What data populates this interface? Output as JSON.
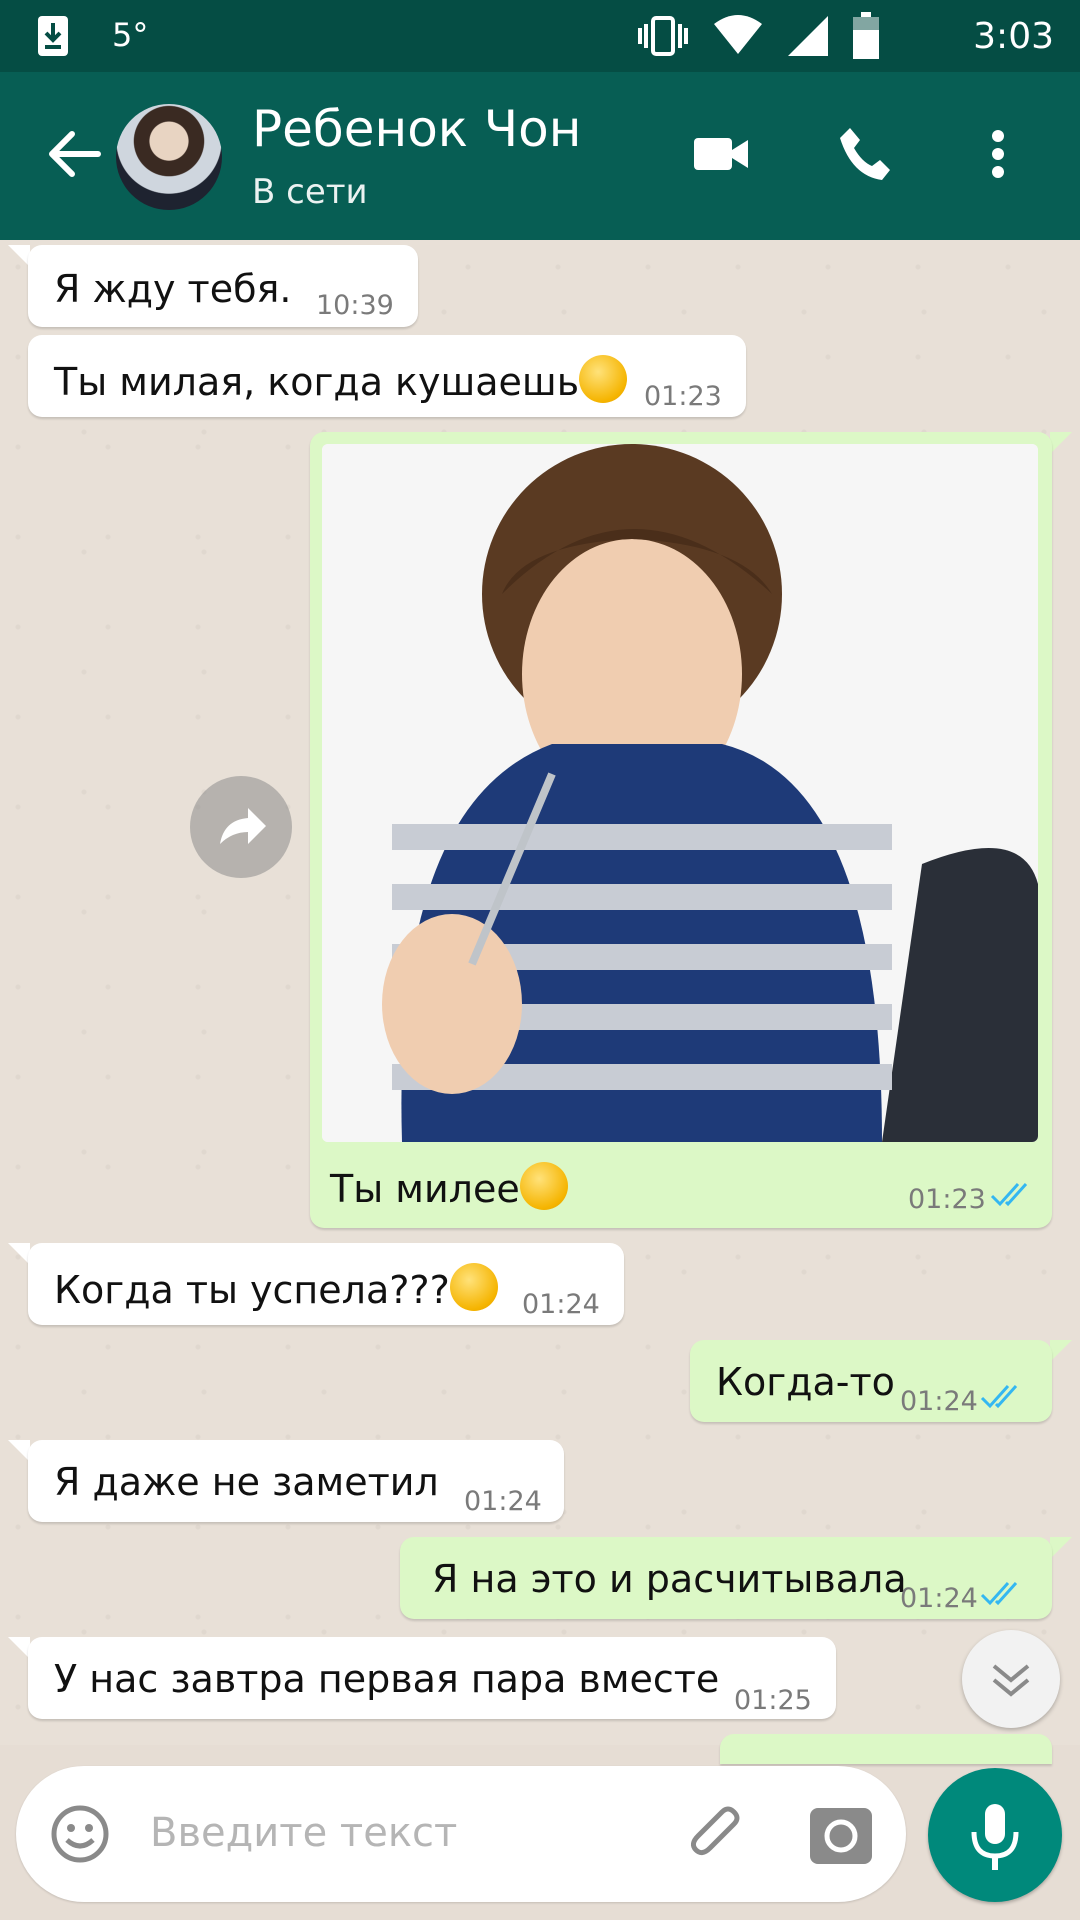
{
  "status_bar": {
    "temperature": "5°",
    "time": "3:03",
    "icons": [
      "download-icon",
      "vibrate-icon",
      "wifi-icon",
      "signal-icon",
      "battery-icon"
    ]
  },
  "header": {
    "contact_name": "Ребенок Чон",
    "contact_status": "В сети",
    "icons": [
      "back-arrow-icon",
      "video-call-icon",
      "phone-icon",
      "more-vert-icon"
    ]
  },
  "messages": [
    {
      "direction": "in",
      "text": "Я жду тебя.",
      "time": "10:39"
    },
    {
      "direction": "in",
      "text": "Ты милая, когда кушаешь",
      "emoji": "smiling-face-emoji",
      "time": "01:23"
    },
    {
      "direction": "out",
      "type": "image",
      "caption": "Ты милее",
      "emoji": "grinning-face-emoji",
      "time": "01:23",
      "read": true
    },
    {
      "direction": "in",
      "text": "Когда ты успела???",
      "emoji": "surprised-face-emoji",
      "time": "01:24"
    },
    {
      "direction": "out",
      "text": "Когда-то",
      "time": "01:24",
      "read": true
    },
    {
      "direction": "in",
      "text": "Я даже не заметил",
      "time": "01:24"
    },
    {
      "direction": "out",
      "text": "Я на это и расчитывала",
      "time": "01:24",
      "read": true
    },
    {
      "direction": "in",
      "text": "У нас завтра первая пара вместе",
      "time": "01:25"
    }
  ],
  "input": {
    "placeholder": "Введите текст",
    "icons": [
      "emoji-icon",
      "attach-icon",
      "camera-icon",
      "mic-icon"
    ]
  },
  "colors": {
    "header": "#075e54",
    "status_bar": "#054d44",
    "outgoing_bubble": "#dcf8c6",
    "incoming_bubble": "#ffffff",
    "read_ticks": "#34b7f1",
    "mic_button": "#00897b"
  }
}
